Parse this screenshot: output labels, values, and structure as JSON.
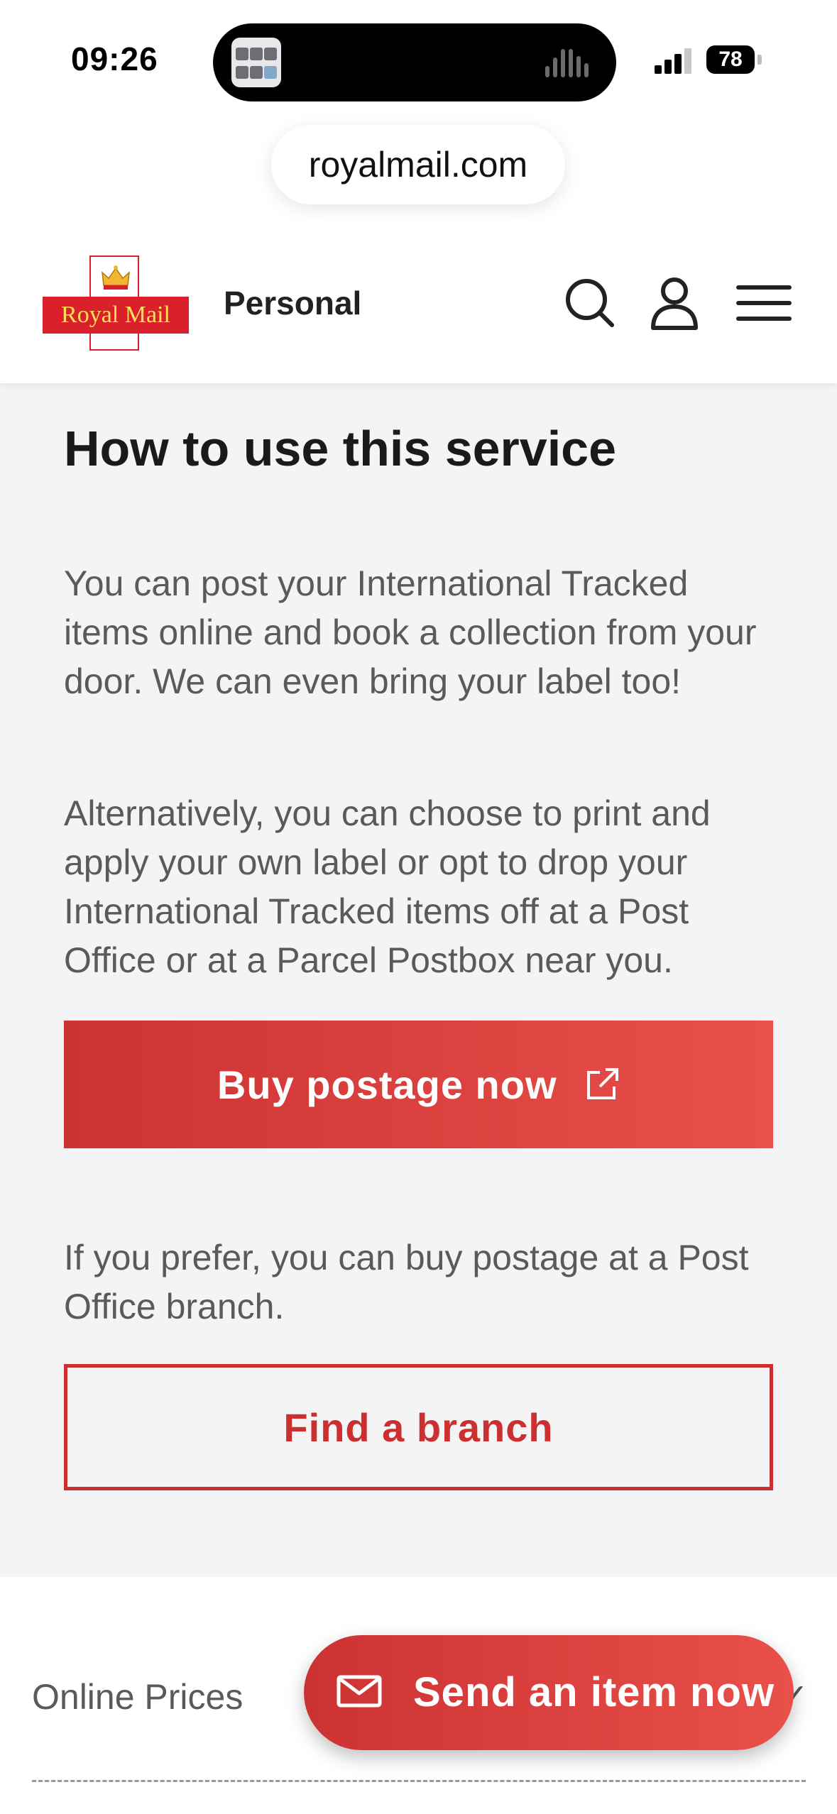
{
  "status_bar": {
    "time": "09:26",
    "battery": "78"
  },
  "browser": {
    "url": "royalmail.com"
  },
  "header": {
    "logo_text": "Royal Mail",
    "nav_label": "Personal"
  },
  "main": {
    "heading": "How to use this service",
    "para1": "You can post your International Tracked items online and book a collection from your door. We can even bring your label too!",
    "para2": "Alternatively, you can choose to print and apply your own label or opt to drop your International Tracked items off at a Post Office or at a Parcel Postbox near you.",
    "buy_button": "Buy postage now",
    "para3": "If you prefer, you can buy postage at a Post Office branch.",
    "find_button": "Find a branch"
  },
  "accordion": {
    "online_prices_label": "Online Prices"
  },
  "fab": {
    "label": "Send an item now"
  },
  "colors": {
    "brand_red": "#da202a",
    "button_red": "#cc3232",
    "section_grey": "#f4f4f4"
  },
  "icons": [
    "search-icon",
    "account-icon",
    "menu-icon",
    "external-link-icon",
    "envelope-icon",
    "chevron-down-icon"
  ]
}
